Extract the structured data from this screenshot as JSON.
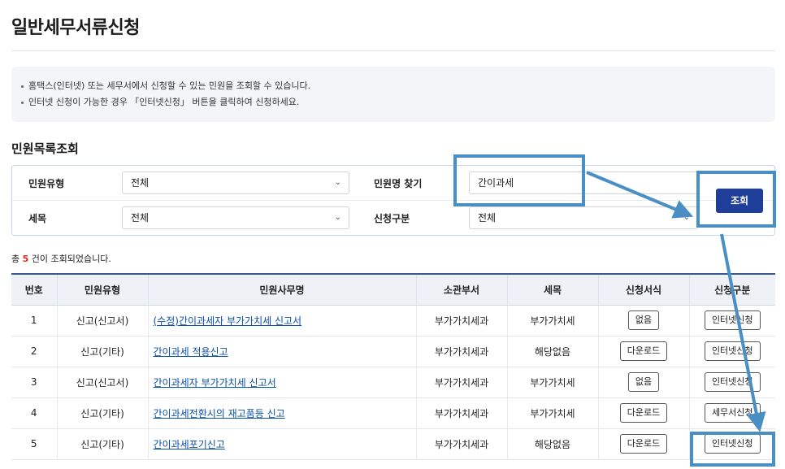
{
  "page": {
    "title": "일반세무서류신청"
  },
  "notice": {
    "lines": [
      "홈택스(인터넷) 또는 세무서에서 신청할 수 있는 민원을 조회할 수 있습니다.",
      "인터넷 신청이 가능한 경우 「인터넷신청」 버튼을 클릭하여 신청하세요."
    ]
  },
  "search": {
    "section_title": "민원목록조회",
    "type_label": "민원유형",
    "type_value": "전체",
    "name_label": "민원명 찾기",
    "name_value": "간이과세",
    "tax_label": "세목",
    "tax_value": "전체",
    "apply_label": "신청구분",
    "apply_value": "전체",
    "button_label": "조회"
  },
  "result": {
    "prefix": "총",
    "count": "5",
    "suffix": "건이 조회되었습니다."
  },
  "table": {
    "headers": [
      "번호",
      "민원유형",
      "민원사무명",
      "소관부서",
      "세목",
      "신청서식",
      "신청구분"
    ],
    "rows": [
      {
        "no": "1",
        "type": "신고(신고서)",
        "name": "(수정)간이과세자 부가가치세 신고서",
        "dept": "부가가치세과",
        "tax": "부가가치세",
        "form": "없음",
        "apply": "인터넷신청"
      },
      {
        "no": "2",
        "type": "신고(기타)",
        "name": "간이과세 적용신고",
        "dept": "부가가치세과",
        "tax": "해당없음",
        "form": "다운로드",
        "apply": "인터넷신청"
      },
      {
        "no": "3",
        "type": "신고(신고서)",
        "name": "간이과세자 부가가치세 신고서",
        "dept": "부가가치세과",
        "tax": "부가가치세",
        "form": "없음",
        "apply": "인터넷신청"
      },
      {
        "no": "4",
        "type": "신고(기타)",
        "name": "간이과세전환시의 재고품등 신고",
        "dept": "부가가치세과",
        "tax": "부가가치세",
        "form": "다운로드",
        "apply": "세무서신청"
      },
      {
        "no": "5",
        "type": "신고(기타)",
        "name": "간이과세포기신고",
        "dept": "부가가치세과",
        "tax": "해당없음",
        "form": "다운로드",
        "apply": "인터넷신청"
      }
    ]
  },
  "colors": {
    "highlight": "#4a8fc4",
    "button": "#1f3e9a",
    "link": "#0a4fa8",
    "count": "#e0281f"
  },
  "icons": {
    "select_chevron": "chevron-down-icon",
    "arrow": "arrow-annotation-icon"
  }
}
